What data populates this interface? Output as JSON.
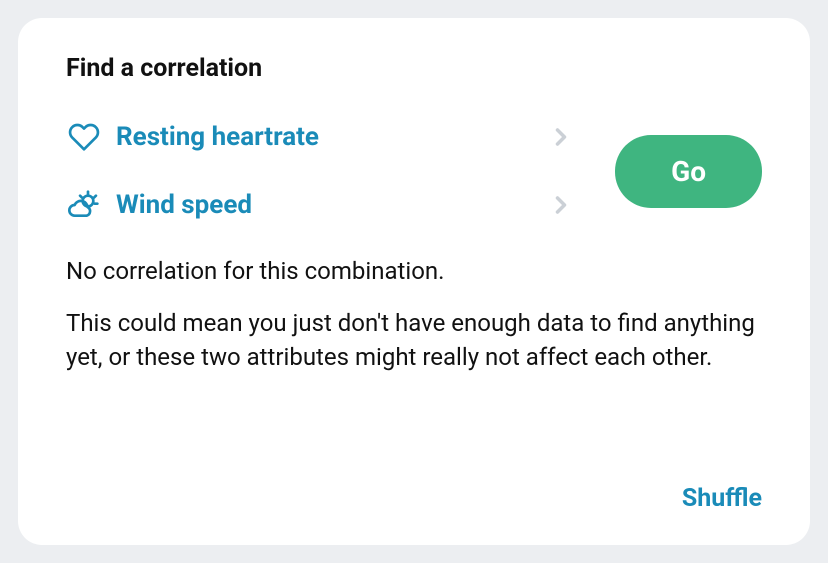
{
  "title": "Find a correlation",
  "selectors": {
    "item1": {
      "label": "Resting heartrate"
    },
    "item2": {
      "label": "Wind speed"
    }
  },
  "go_button_label": "Go",
  "message": "No correlation for this combination.",
  "explanation": "This could mean you just don't have enough data to find anything yet, or these two attributes might really not affect each other.",
  "shuffle_label": "Shuffle"
}
